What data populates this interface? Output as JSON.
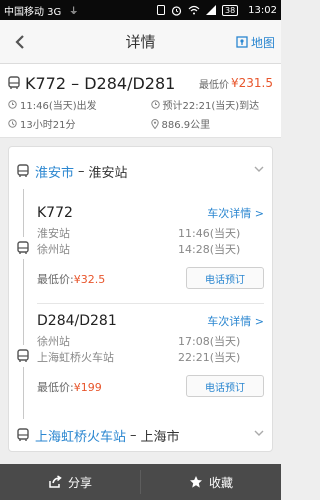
{
  "status_bar": {
    "carrier": "中国移动 3G",
    "usb_icon": "usb-icon",
    "battery": "38",
    "time": "13:02"
  },
  "header": {
    "title": "详情",
    "map_label": "地图"
  },
  "summary": {
    "route": "K772 – D284/D281",
    "lowest_label": "最低价",
    "lowest_price": "¥231.5",
    "depart": "11:46(当天)出发",
    "arrive": "预计22:21(当天)到达",
    "duration": "13小时21分",
    "distance": "886.9公里"
  },
  "origin": {
    "city": "淮安市",
    "dash": "–",
    "station": "淮安站"
  },
  "segments": [
    {
      "train_no": "K772",
      "detail_label": "车次详情 >",
      "from_station": "淮安站",
      "from_time": "11:46(当天)",
      "to_station": "徐州站",
      "to_time": "14:28(当天)",
      "lowest_label": "最低价:",
      "lowest_price": "¥32.5",
      "call_label": "电话预订"
    },
    {
      "train_no": "D284/D281",
      "detail_label": "车次详情 >",
      "from_station": "徐州站",
      "from_time": "17:08(当天)",
      "to_station": "上海虹桥火车站",
      "to_time": "22:21(当天)",
      "lowest_label": "最低价:",
      "lowest_price": "¥199",
      "call_label": "电话预订"
    }
  ],
  "destination": {
    "station": "上海虹桥火车站",
    "dash": "–",
    "city": "上海市"
  },
  "bottom_bar": {
    "share_label": "分享",
    "favorite_label": "收藏"
  },
  "colors": {
    "accent": "#2a86d0",
    "price": "#e8552b",
    "bottom_bar": "#4a4a4a"
  }
}
